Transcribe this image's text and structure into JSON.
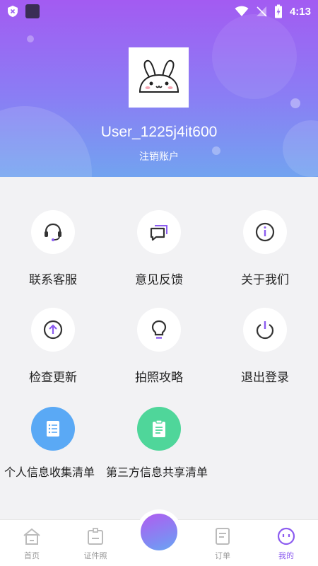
{
  "status_bar": {
    "time": "4:13"
  },
  "profile": {
    "username": "User_1225j4it600",
    "deregister_label": "注销账户"
  },
  "menu": [
    {
      "label": "联系客服",
      "icon": "headset-icon"
    },
    {
      "label": "意见反馈",
      "icon": "chat-bubbles-icon"
    },
    {
      "label": "关于我们",
      "icon": "info-icon"
    },
    {
      "label": "检查更新",
      "icon": "upload-arrow-icon"
    },
    {
      "label": "拍照攻略",
      "icon": "lightbulb-icon"
    },
    {
      "label": "退出登录",
      "icon": "power-icon"
    },
    {
      "label": "个人信息收集清单",
      "icon": "list-doc-icon"
    },
    {
      "label": "第三方信息共享清单",
      "icon": "clipboard-icon"
    }
  ],
  "tabbar": {
    "tabs": [
      {
        "label": "首页",
        "icon": "home-icon"
      },
      {
        "label": "证件照",
        "icon": "id-photo-icon"
      },
      {
        "label": "订单",
        "icon": "order-icon"
      },
      {
        "label": "我的",
        "icon": "profile-face-icon",
        "active": true
      }
    ]
  },
  "colors": {
    "accent": "#8c5cf0",
    "header_top": "#a35bf2",
    "header_bottom": "#72a3f0",
    "blue_tile": "#5aa9f5",
    "green_tile": "#4fd69a"
  }
}
